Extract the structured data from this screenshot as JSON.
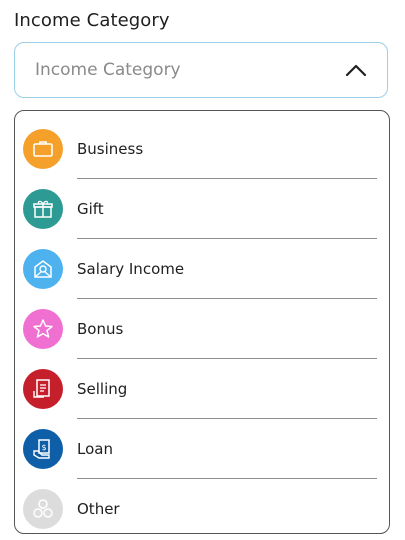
{
  "field": {
    "label": "Income Category",
    "placeholder": "Income Category"
  },
  "options": [
    {
      "label": "Business",
      "icon": "briefcase-icon",
      "color": "#F6A02C"
    },
    {
      "label": "Gift",
      "icon": "gift-icon",
      "color": "#2E9A94"
    },
    {
      "label": "Salary Income",
      "icon": "salary-icon",
      "color": "#4DB2EE"
    },
    {
      "label": "Bonus",
      "icon": "star-icon",
      "color": "#F070D2"
    },
    {
      "label": "Selling",
      "icon": "receipt-icon",
      "color": "#C41F2A"
    },
    {
      "label": "Loan",
      "icon": "loan-icon",
      "color": "#0E5FA8"
    },
    {
      "label": "Other",
      "icon": "other-icon",
      "color": "#DCDCDC"
    }
  ]
}
